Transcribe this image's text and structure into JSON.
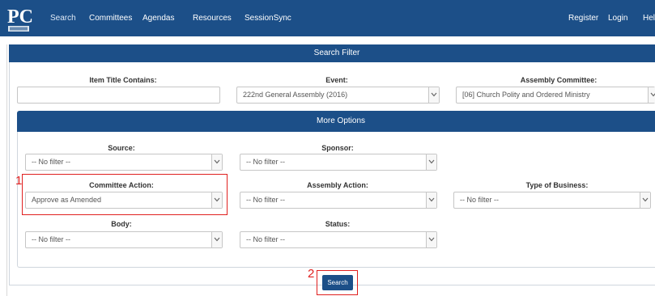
{
  "nav": {
    "logo_text": "PC",
    "items": [
      "Search",
      "Committees",
      "Agendas",
      "Resources",
      "SessionSync"
    ],
    "right_items": [
      "Register",
      "Login",
      "Hel"
    ]
  },
  "search_filter": {
    "title": "Search Filter",
    "item_title_label": "Item Title Contains:",
    "item_title_value": "",
    "event_label": "Event:",
    "event_value": "222nd General Assembly (2016)",
    "assembly_committee_label": "Assembly Committee:",
    "assembly_committee_value": "[06] Church Polity and Ordered Ministry"
  },
  "more_options": {
    "title": "More Options",
    "source_label": "Source:",
    "source_value": "-- No filter --",
    "sponsor_label": "Sponsor:",
    "sponsor_value": "-- No filter --",
    "committee_action_label": "Committee Action:",
    "committee_action_value": "Approve as Amended",
    "assembly_action_label": "Assembly Action:",
    "assembly_action_value": "-- No filter --",
    "type_of_business_label": "Type of Business:",
    "type_of_business_value": "-- No filter --",
    "body_label": "Body:",
    "body_value": "-- No filter --",
    "status_label": "Status:",
    "status_value": "-- No filter --"
  },
  "search_button_label": "Search",
  "annotations": {
    "one": "1",
    "two": "2"
  },
  "colors": {
    "nav_bg": "#1c4f88",
    "highlight": "#e0201f"
  }
}
